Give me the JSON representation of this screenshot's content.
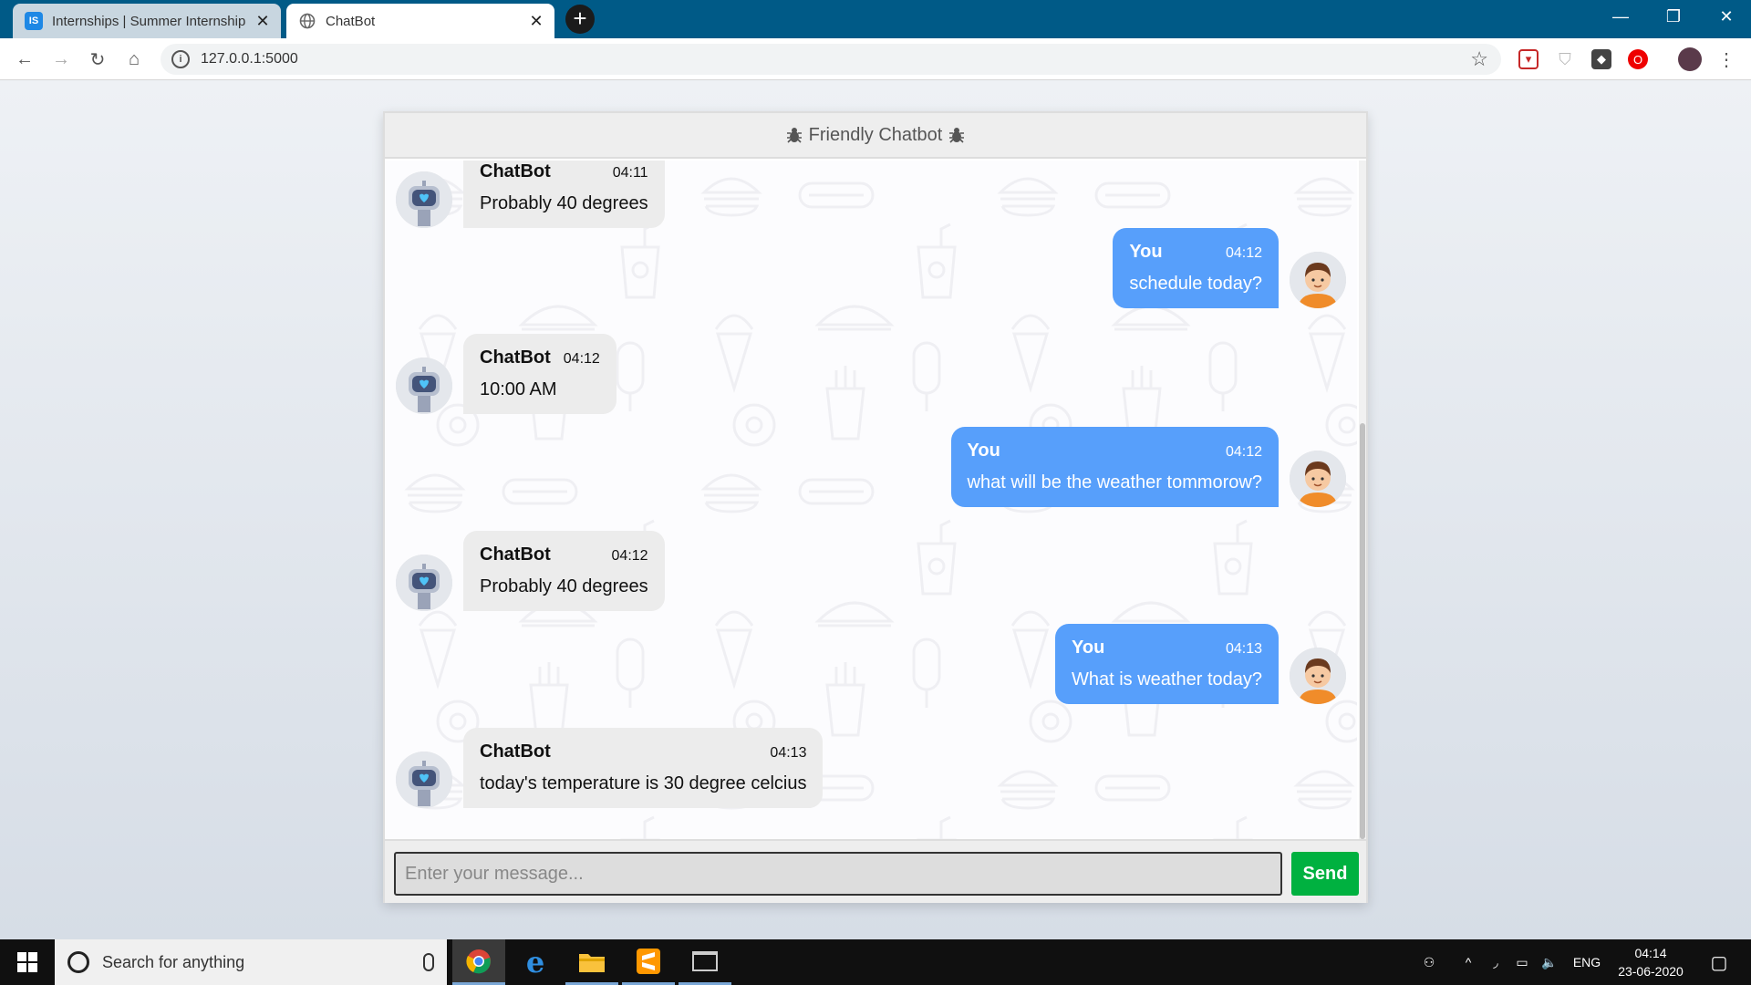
{
  "browser": {
    "tabs": [
      {
        "title": "Internships | Summer Internship",
        "favicon": "IS"
      },
      {
        "title": "ChatBot",
        "favicon": "globe-icon"
      }
    ],
    "url": "127.0.0.1:5000"
  },
  "chat": {
    "header_title": "Friendly Chatbot",
    "messages": [
      {
        "side": "left",
        "name": "ChatBot",
        "time": "04:11",
        "text": "Probably 40 degrees"
      },
      {
        "side": "right",
        "name": "You",
        "time": "04:12",
        "text": "schedule today?"
      },
      {
        "side": "left",
        "name": "ChatBot",
        "time": "04:12",
        "text": "10:00 AM"
      },
      {
        "side": "right",
        "name": "You",
        "time": "04:12",
        "text": "what will be the weather tommorow?"
      },
      {
        "side": "left",
        "name": "ChatBot",
        "time": "04:12",
        "text": "Probably 40 degrees"
      },
      {
        "side": "right",
        "name": "You",
        "time": "04:13",
        "text": "What is weather today?"
      },
      {
        "side": "left",
        "name": "ChatBot",
        "time": "04:13",
        "text": "today's temperature is 30 degree celcius"
      }
    ],
    "input_placeholder": "Enter your message...",
    "input_value": "",
    "send_label": "Send"
  },
  "taskbar": {
    "search_placeholder": "Search for anything",
    "language": "ENG",
    "time": "04:14",
    "date": "23-06-2020"
  },
  "colors": {
    "user_bubble": "#579ffb",
    "send_button": "#00b140",
    "tabstrip": "#005a87"
  }
}
